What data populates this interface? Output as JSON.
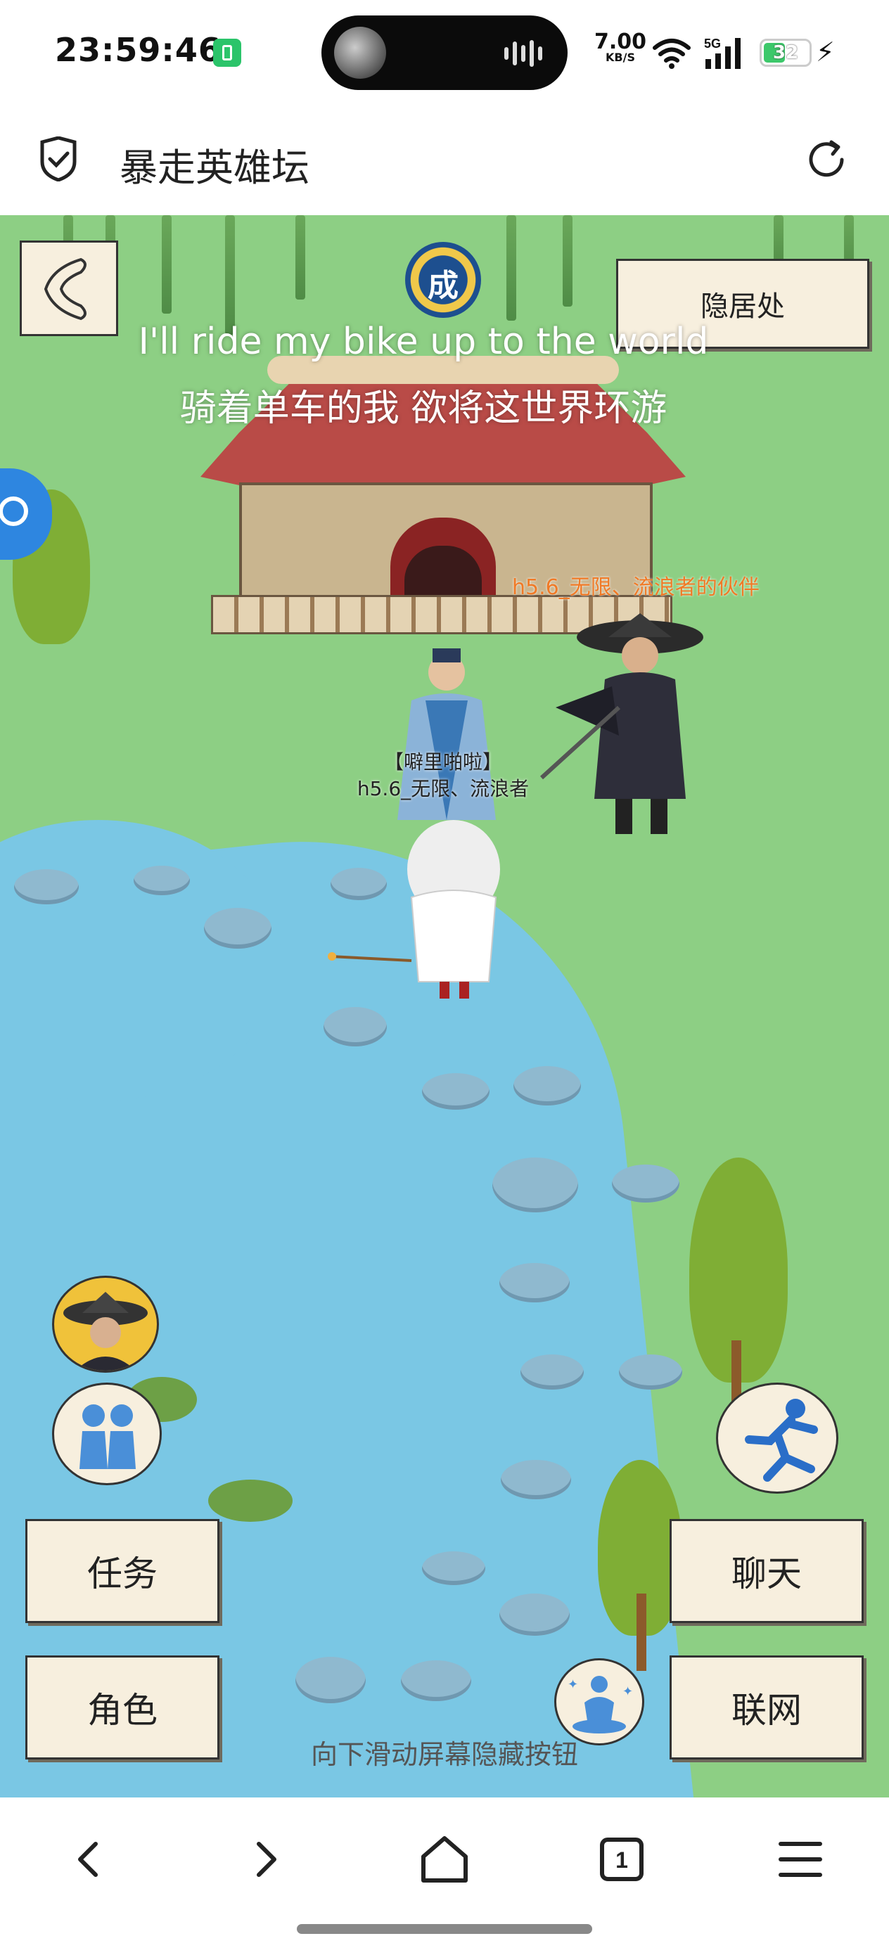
{
  "status_bar": {
    "time": "23:59:46",
    "net_speed_value": "7.00",
    "net_speed_unit": "KB/S",
    "network": "5G",
    "battery": "32"
  },
  "browser": {
    "site_title": "暴走英雄坛"
  },
  "game": {
    "lyrics": {
      "line1": "I'll ride my bike up to the world",
      "line2": "骑着单车的我 欲将这世界环游"
    },
    "emblem_text": "成",
    "buttons": {
      "retreat": "隐居处",
      "quest": "任务",
      "chat": "聊天",
      "character": "角色",
      "network": "联网"
    },
    "players": {
      "companion_tag": "h5.6_无限、流浪者的伙伴",
      "player_title": "【噼里啪啦】",
      "player_name": "h5.6_无限、流浪者"
    },
    "hint": "向下滑动屏幕隐藏按钮"
  },
  "colors": {
    "grass": "#8dcf84",
    "water": "#7ac7e4",
    "button_bg": "#f7efde",
    "name_orange": "#f07a26"
  }
}
